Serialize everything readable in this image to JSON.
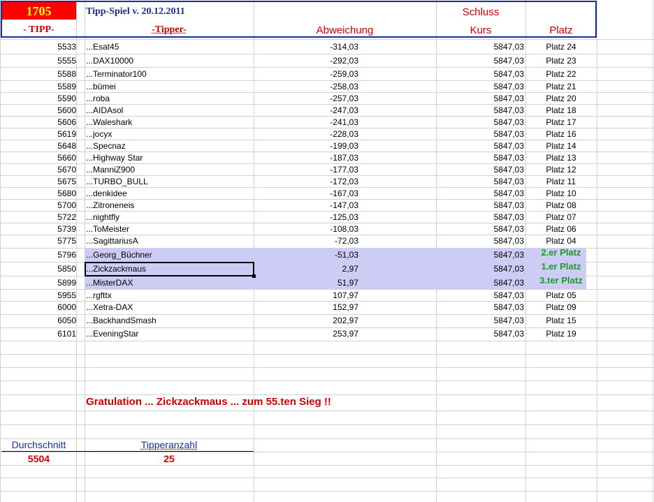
{
  "header": {
    "tipp_number": "1705",
    "title": "Tipp-Spiel v. 20.12.2011",
    "schluss": "Schluss",
    "col_tipp": "- TIPP-",
    "col_tipper": "-Tipper-",
    "col_abweichung": "Abweichung",
    "col_kurs": "Kurs",
    "col_platz": "Platz"
  },
  "rows": [
    {
      "tipp": "5533",
      "tipper": "...Esat45",
      "abw": "-314,03",
      "kurs": "5847,03",
      "platz": "Platz 24"
    },
    {
      "tipp": "5555",
      "tipper": "...DAX10000",
      "abw": "-292,03",
      "kurs": "5847,03",
      "platz": "Platz 23"
    },
    {
      "tipp": "5588",
      "tipper": "...Terminator100",
      "abw": "-259,03",
      "kurs": "5847,03",
      "platz": "Platz 22"
    },
    {
      "tipp": "5589",
      "tipper": "...bümei",
      "abw": "-258,03",
      "kurs": "5847,03",
      "platz": "Platz 21"
    },
    {
      "tipp": "5590",
      "tipper": "...roba",
      "abw": "-257,03",
      "kurs": "5847,03",
      "platz": "Platz 20"
    },
    {
      "tipp": "5600",
      "tipper": "...AIDAsol",
      "abw": "-247,03",
      "kurs": "5847,03",
      "platz": "Platz 18"
    },
    {
      "tipp": "5606",
      "tipper": "...Waleshark",
      "abw": "-241,03",
      "kurs": "5847,03",
      "platz": "Platz 17"
    },
    {
      "tipp": "5619",
      "tipper": "...jocyx",
      "abw": "-228,03",
      "kurs": "5847,03",
      "platz": "Platz 16"
    },
    {
      "tipp": "5648",
      "tipper": "...Specnaz",
      "abw": "-199,03",
      "kurs": "5847,03",
      "platz": "Platz 14"
    },
    {
      "tipp": "5660",
      "tipper": "...Highway Star",
      "abw": "-187,03",
      "kurs": "5847,03",
      "platz": "Platz 13"
    },
    {
      "tipp": "5670",
      "tipper": "...ManniZ900",
      "abw": "-177,03",
      "kurs": "5847,03",
      "platz": "Platz 12"
    },
    {
      "tipp": "5675",
      "tipper": "...TURBO_BULL",
      "abw": "-172,03",
      "kurs": "5847,03",
      "platz": "Platz 11"
    },
    {
      "tipp": "5680",
      "tipper": "...denkidee",
      "abw": "-167,03",
      "kurs": "5847,03",
      "platz": "Platz 10"
    },
    {
      "tipp": "5700",
      "tipper": "...Zitroneneis",
      "abw": "-147,03",
      "kurs": "5847,03",
      "platz": "Platz 08"
    },
    {
      "tipp": "5722",
      "tipper": "...nightfly",
      "abw": "-125,03",
      "kurs": "5847,03",
      "platz": "Platz 07"
    },
    {
      "tipp": "5739",
      "tipper": "...ToMeister",
      "abw": "-108,03",
      "kurs": "5847,03",
      "platz": "Platz 06"
    },
    {
      "tipp": "5775",
      "tipper": "...SagittariusA",
      "abw": "-72,03",
      "kurs": "5847,03",
      "platz": "Platz 04"
    },
    {
      "tipp": "5796",
      "tipper": "...Georg_Büchner",
      "abw": "-51,03",
      "kurs": "5847,03",
      "platz": "2.er Platz"
    },
    {
      "tipp": "5850",
      "tipper": "...Zickzackmaus",
      "abw": "2,97",
      "kurs": "5847,03",
      "platz": "1.er Platz"
    },
    {
      "tipp": "5899",
      "tipper": "...MisterDAX",
      "abw": "51,97",
      "kurs": "5847,03",
      "platz": "3.ter Platz"
    },
    {
      "tipp": "5955",
      "tipper": "...rgfttx",
      "abw": "107,97",
      "kurs": "5847,03",
      "platz": "Platz 05"
    },
    {
      "tipp": "6000",
      "tipper": "...Xetra-DAX",
      "abw": "152,97",
      "kurs": "5847,03",
      "platz": "Platz 09"
    },
    {
      "tipp": "6050",
      "tipper": "...BackhandSmash",
      "abw": "202,97",
      "kurs": "5847,03",
      "platz": "Platz 15"
    },
    {
      "tipp": "6101",
      "tipper": "...EveningStar",
      "abw": "253,97",
      "kurs": "5847,03",
      "platz": "Platz 19"
    }
  ],
  "gratulation": "Gratulation ... Zickzackmaus ... zum  55.ten Sieg !!",
  "footer": {
    "durchschnitt_label": "Durchschnitt",
    "durchschnitt_value": "5504",
    "tipperanzahl_label": "Tipperanzahl",
    "tipperanzahl_value": "25"
  },
  "colors": {
    "header_border": "#1c2aa0",
    "highlight": "#ccccf5",
    "winner_green": "#1a9a2a",
    "red_text": "#cc0000",
    "tipp_number_bg": "#ff0000",
    "tipp_number_fg": "#ffff00"
  }
}
